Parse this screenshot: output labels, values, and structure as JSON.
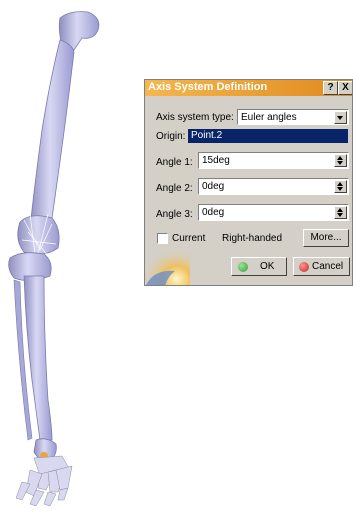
{
  "dialog": {
    "title": "Axis System Definition",
    "help_button": "?",
    "close_button": "X",
    "axis_type_label": "Axis system type:",
    "axis_type_value": "Euler angles",
    "origin_label": "Origin:",
    "origin_value": "Point.2",
    "angles": [
      {
        "label": "Angle 1:",
        "value": "15deg"
      },
      {
        "label": "Angle 2:",
        "value": "0deg"
      },
      {
        "label": "Angle 3:",
        "value": "0deg"
      }
    ],
    "current_label": "Current",
    "current_checked": false,
    "handedness": "Right-handed",
    "more_button": "More...",
    "ok_button": "OK",
    "cancel_button": "Cancel"
  },
  "colors": {
    "title_bar": "#f0a43a",
    "origin_highlight": "#0a246a",
    "ok_icon": "#2e9e2e",
    "cancel_icon": "#d02020",
    "bone": "#c9c9ee"
  },
  "icons": [
    "help-icon",
    "close-icon",
    "dropdown-arrow-icon",
    "spin-up-icon",
    "spin-down-icon",
    "ok-icon",
    "cancel-icon"
  ]
}
